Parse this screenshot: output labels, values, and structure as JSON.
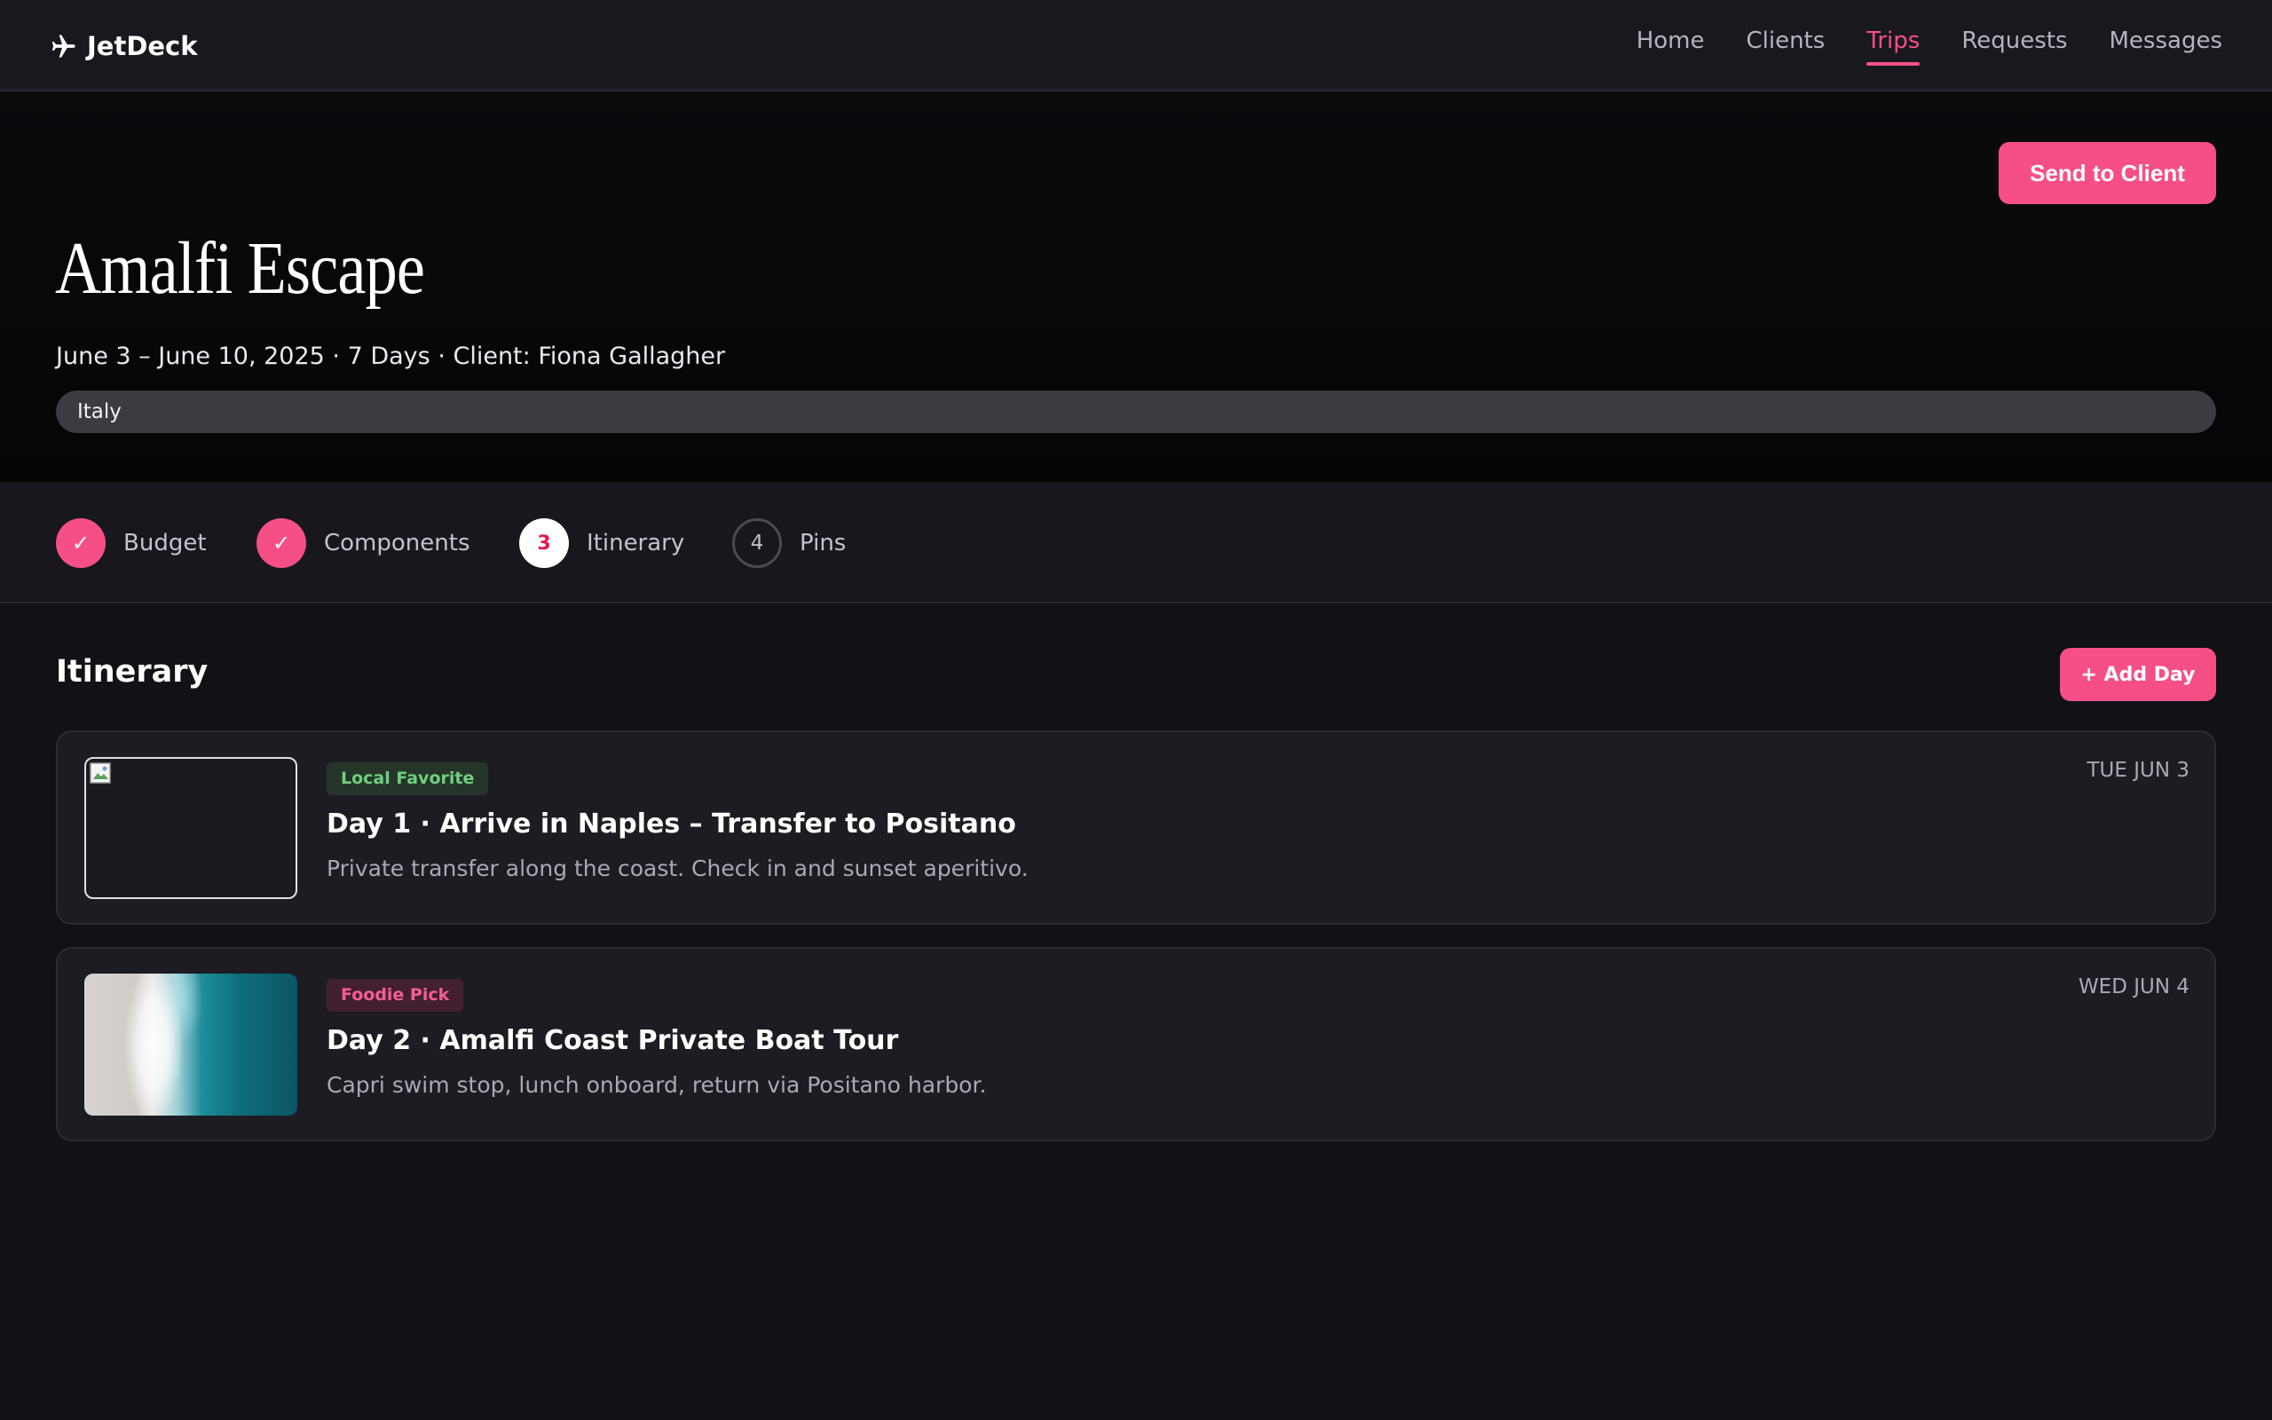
{
  "brand": {
    "name": "JetDeck",
    "icon": "airplane-icon"
  },
  "nav": [
    {
      "label": "Home",
      "active": false
    },
    {
      "label": "Clients",
      "active": false
    },
    {
      "label": "Trips",
      "active": true
    },
    {
      "label": "Requests",
      "active": false
    },
    {
      "label": "Messages",
      "active": false
    }
  ],
  "hero": {
    "send_label": "Send to Client",
    "title": "Amalfi Escape",
    "meta": "June 3 – June 10, 2025 · 7 Days · Client: Fiona Gallagher",
    "region": "Italy"
  },
  "steps": [
    {
      "label": "Budget",
      "state": "done",
      "marker": "✓"
    },
    {
      "label": "Components",
      "state": "done",
      "marker": "✓"
    },
    {
      "label": "Itinerary",
      "state": "current",
      "marker": "3"
    },
    {
      "label": "Pins",
      "state": "todo",
      "marker": "4"
    }
  ],
  "itinerary": {
    "title": "Itinerary",
    "add_label": "+ Add Day",
    "days": [
      {
        "tag": "Local Favorite",
        "tag_color": "#6ed07d",
        "title": "Day 1 · Arrive in Naples – Transfer to Positano",
        "description": "Private transfer along the coast. Check in and sunset aperitivo.",
        "date": "TUE JUN 3",
        "image": "broken-image-icon"
      },
      {
        "tag": "Foodie Pick",
        "tag_color": "#f45d94",
        "title": "Day 2 · Amalfi Coast Private Boat Tour",
        "description": "Capri swim stop, lunch onboard, return via Positano harbor.",
        "date": "WED JUN 4",
        "image": "aerial-ocean-photo"
      }
    ]
  },
  "colors": {
    "accent": "#f64f88",
    "background": "#111116",
    "nav_background": "#18181e"
  }
}
